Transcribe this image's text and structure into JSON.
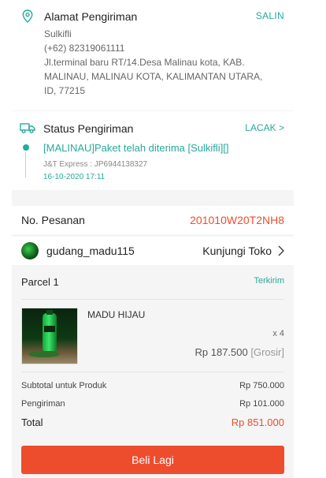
{
  "address": {
    "title": "Alamat Pengiriman",
    "copy_label": "SALIN",
    "name": "Sulkifli",
    "phone": "(+62) 82319061111",
    "line1": "Jl.terminal baru RT/14.Desa Malinau kota, KAB.",
    "line2": "MALINAU, MALINAU KOTA, KALIMANTAN UTARA,",
    "line3": "ID, 77215"
  },
  "shipping": {
    "title": "Status Pengiriman",
    "track_label": "LACAK >",
    "event": "[MALINAU]Paket telah diterima [Sulkifli][]",
    "courier": "J&T Express :  JP6944138327",
    "time": "16-10-2020 17:11"
  },
  "order": {
    "label": "No. Pesanan",
    "number": "201010W20T2NH8"
  },
  "shop": {
    "name": "gudang_madu115",
    "visit_label": "Kunjungi Toko"
  },
  "parcel": {
    "label": "Parcel 1",
    "status": "Terkirim",
    "product_name": "MADU HIJAU",
    "quantity": "x 4",
    "price": "Rp 187.500",
    "price_type": "[Grosir]",
    "subtotal_label": "Subtotal untuk Produk",
    "subtotal_value": "Rp 750.000",
    "shipping_label": "Pengiriman",
    "shipping_value": "Rp 101.000",
    "total_label": "Total",
    "total_value": "Rp 851.000"
  },
  "buy_again_label": "Beli Lagi",
  "colors": {
    "accent": "#26aa99",
    "brand": "#ee4d2d"
  }
}
